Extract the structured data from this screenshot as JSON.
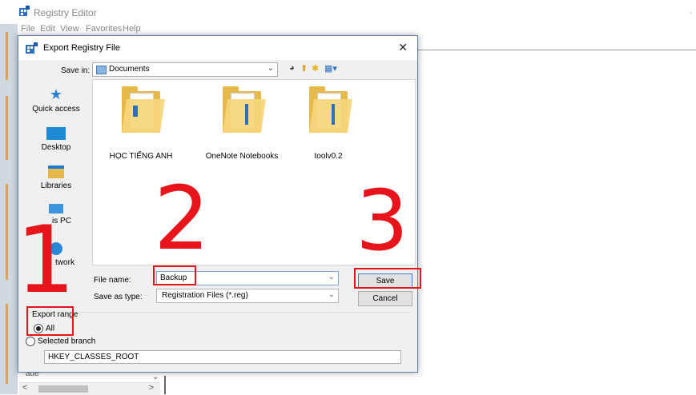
{
  "registry_editor": {
    "title": "Registry Editor",
    "menu": [
      "File",
      "Edit",
      "View",
      "Favorites",
      "Help"
    ],
    "minimize_glyph": "-",
    "tree_partial_text": "aue"
  },
  "dialog": {
    "title": "Export Registry File",
    "close_glyph": "✕",
    "save_in": {
      "label": "Save in:",
      "value": "Documents"
    },
    "places": [
      {
        "label": "Quick access",
        "icon": "star-icon"
      },
      {
        "label": "Desktop",
        "icon": "desktop-icon"
      },
      {
        "label": "Libraries",
        "icon": "libraries-icon"
      },
      {
        "label": "is PC",
        "icon": "this-pc-icon"
      },
      {
        "label": "twork",
        "icon": "network-icon"
      }
    ],
    "files": [
      {
        "name": "HỌC TIẾNG ANH",
        "icon": "folder-icon"
      },
      {
        "name": "OneNote Notebooks",
        "icon": "folder-icon"
      },
      {
        "name": "toolv0.2",
        "icon": "folder-icon"
      }
    ],
    "file_name": {
      "label": "File name:",
      "value": "Backup"
    },
    "save_as_type": {
      "label": "Save as type:",
      "value": "Registration Files (*.reg)"
    },
    "save_button": "Save",
    "cancel_button": "Cancel",
    "export_range": {
      "label": "Export range",
      "options": [
        {
          "label": "All",
          "checked": true
        },
        {
          "label": "Selected branch",
          "checked": false
        }
      ],
      "branch_value": "HKEY_CLASSES_ROOT"
    }
  },
  "annotations": {
    "step1": "1",
    "step2": "2",
    "step3": "3",
    "color": "#e8141b"
  }
}
